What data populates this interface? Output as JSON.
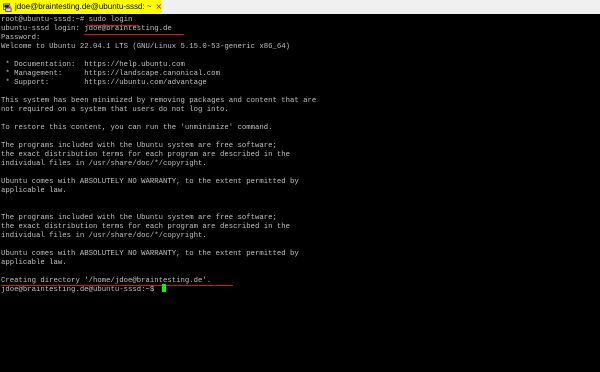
{
  "window": {
    "title": "jdoe@braintesting.de@ubuntu-sssd: ~",
    "close_symbol": "×",
    "icon": "putty-terminal-icon",
    "tab_color": "#ffff00"
  },
  "colors": {
    "background": "#000000",
    "text": "#c0c0c0",
    "cursor": "#00ff00",
    "annotation": "#e0101a"
  },
  "terminal": {
    "lines": [
      "root@ubuntu-sssd:~# sudo login",
      "ubuntu-sssd login: jdoe@braintesting.de",
      "Password:",
      "Welcome to Ubuntu 22.04.1 LTS (GNU/Linux 5.15.0-53-generic x86_64)",
      "",
      " * Documentation:  https://help.ubuntu.com",
      " * Management:     https://landscape.canonical.com",
      " * Support:        https://ubuntu.com/advantage",
      "",
      "This system has been minimized by removing packages and content that are",
      "not required on a system that users do not log into.",
      "",
      "To restore this content, you can run the 'unminimize' command.",
      "",
      "The programs included with the Ubuntu system are free software;",
      "the exact distribution terms for each program are described in the",
      "individual files in /usr/share/doc/*/copyright.",
      "",
      "Ubuntu comes with ABSOLUTELY NO WARRANTY, to the extent permitted by",
      "applicable law.",
      "",
      "",
      "The programs included with the Ubuntu system are free software;",
      "the exact distribution terms for each program are described in the",
      "individual files in /usr/share/doc/*/copyright.",
      "",
      "Ubuntu comes with ABSOLUTELY NO WARRANTY, to the extent permitted by",
      "applicable law.",
      "",
      "Creating directory '/home/jdoe@braintesting.de'.",
      "jdoe@braintesting.de@ubuntu-sssd:~$ "
    ]
  }
}
